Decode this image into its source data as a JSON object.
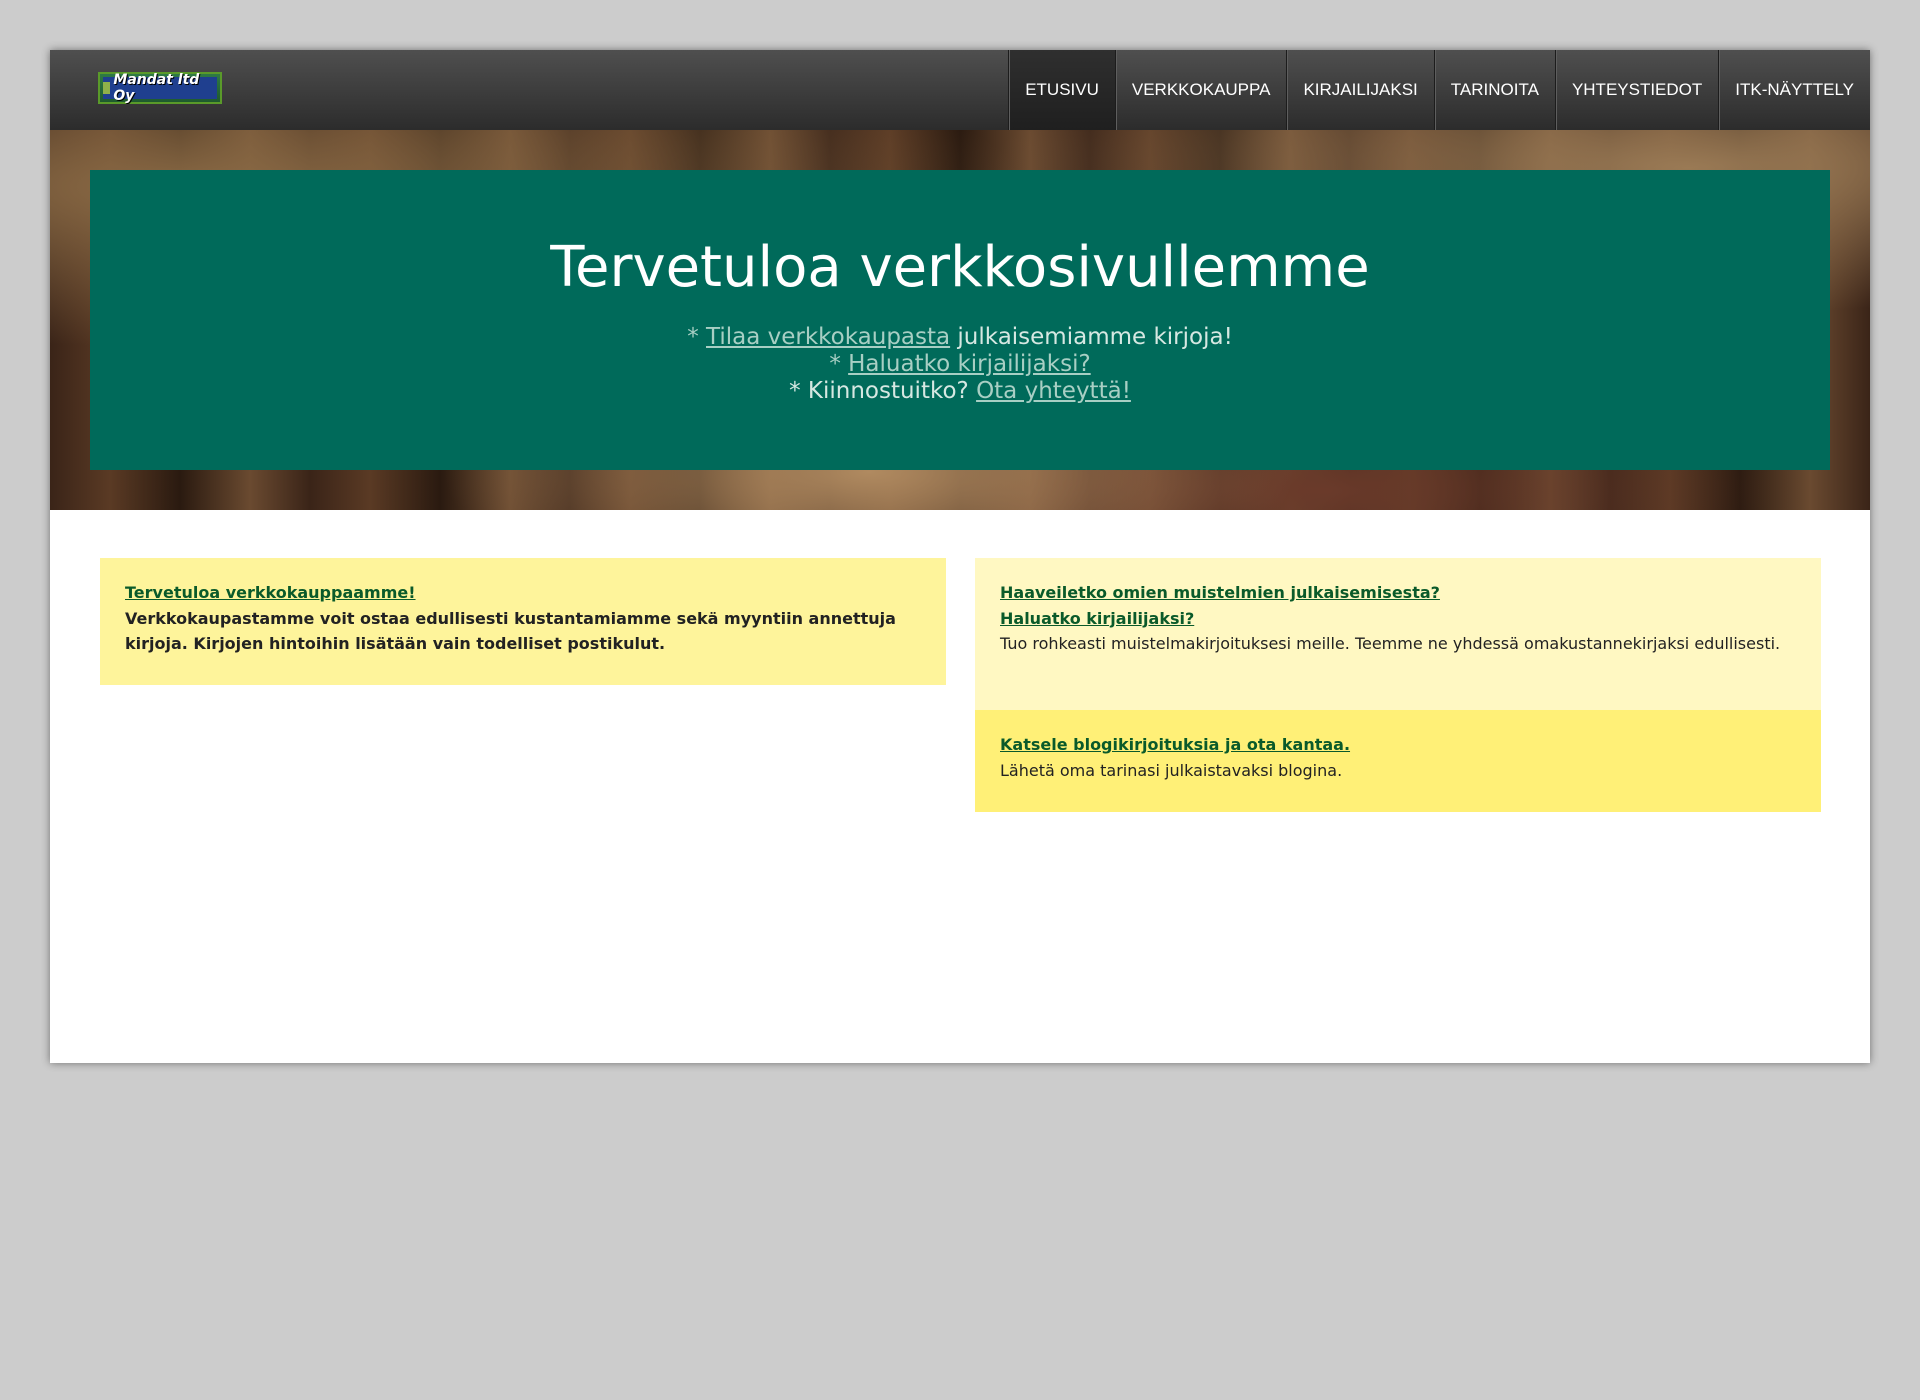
{
  "logo": {
    "text": "Mandat ltd Oy"
  },
  "nav": {
    "items": [
      {
        "label": "ETUSIVU",
        "active": true
      },
      {
        "label": "VERKKOKAUPPA"
      },
      {
        "label": "KIRJAILIJAKSI"
      },
      {
        "label": "TARINOITA"
      },
      {
        "label": "YHTEYSTIEDOT"
      },
      {
        "label": "ITK-NÄYTTELY"
      }
    ]
  },
  "hero": {
    "title": "Tervetuloa verkkosivullemme",
    "line1": {
      "prefix": "* ",
      "link": "Tilaa verkkokaupasta",
      "suffix": " julkaisemiamme kirjoja!"
    },
    "line2": {
      "prefix": "* ",
      "link": "Haluatko kirjailijaksi?"
    },
    "line3": {
      "prefix": "* Kiinnostuitko? ",
      "link": "Ota yhteyttä!"
    }
  },
  "cards": {
    "shop": {
      "link": "Tervetuloa verkkokauppaamme!",
      "text": "Verkkokaupastamme voit ostaa edullisesti kustantamiamme sekä myyntiin annettuja kirjoja. Kirjojen hintoihin lisätään vain todelliset postikulut."
    },
    "author": {
      "link1": "Haaveiletko omien muistelmien julkaisemisesta?",
      "link2": "Haluatko kirjailijaksi?",
      "text": "Tuo rohkeasti muistelmakirjoituksesi meille. Teemme ne yhdessä omakustannekirjaksi edullisesti."
    },
    "blog": {
      "link": "Katsele blogikirjoituksia ja ota kantaa.",
      "text": "Lähetä oma tarinasi julkaistavaksi blogina."
    }
  },
  "colors": {
    "hero_box": "#006a5a",
    "card_shop": "#fef49b",
    "card_author": "#fff8c2",
    "card_blog": "#fff077",
    "link": "#0a5a2a"
  }
}
